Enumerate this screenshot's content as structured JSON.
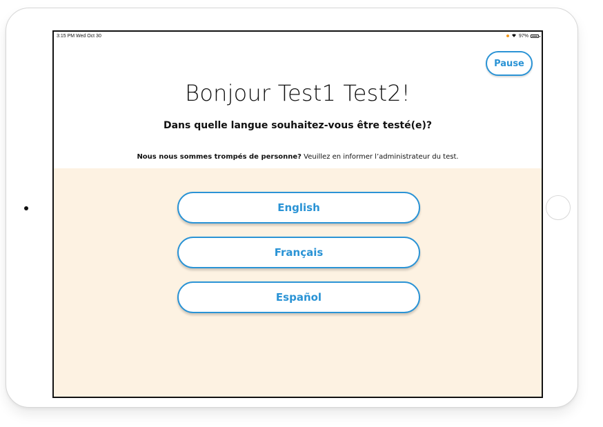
{
  "status_bar": {
    "time": "3:15 PM  Wed Oct 30",
    "wifi_icon": "wifi-icon",
    "battery_percent": "97%",
    "battery_icon": "battery-icon",
    "recording_dot_color": "#f29a1f"
  },
  "header": {
    "pause_label": "Pause"
  },
  "main": {
    "greeting": "Bonjour Test1 Test2!",
    "question": "Dans quelle langue souhaitez-vous être testé(e)?",
    "notice_bold": "Nous nous sommes trompés de personne?",
    "notice_rest": " Veuillez en informer l’administrateur du test."
  },
  "languages": [
    {
      "label": "English"
    },
    {
      "label": "Français"
    },
    {
      "label": "Español"
    }
  ],
  "colors": {
    "accent": "#2a93d5",
    "panel_background": "#fdf2e2"
  }
}
